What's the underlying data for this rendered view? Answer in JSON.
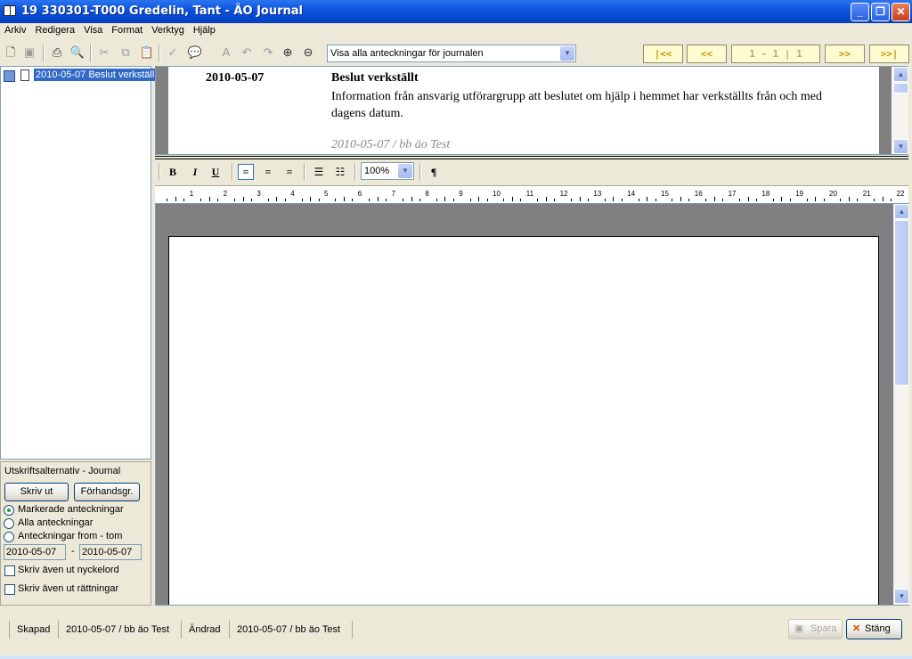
{
  "window": {
    "title": "19 330301-T000 Gredelin, Tant - ÄO Journal",
    "controls": {
      "minimize": "minimize-icon",
      "restore": "restore-icon",
      "close": "close-icon"
    }
  },
  "menu": [
    "Arkiv",
    "Redigera",
    "Visa",
    "Format",
    "Verktyg",
    "Hjälp"
  ],
  "toolbar": {
    "view_filter": "Visa alla anteckningar för journalen",
    "nav_first": "|<<",
    "nav_prev": "<<",
    "nav_position": "1 - 1 | 1",
    "nav_next": ">>",
    "nav_last": ">>|"
  },
  "tree": {
    "items": [
      {
        "label": "2010-05-07 Beslut verkställ"
      }
    ]
  },
  "print_options": {
    "header": "Utskriftsalternativ - Journal",
    "print_button": "Skriv ut",
    "preview_button": "Förhandsgr.",
    "radio_marked": "Markerade anteckningar",
    "radio_all": "Alla anteckningar",
    "radio_range": "Anteckningar from - tom",
    "selected_radio": "marked",
    "date_from": "2010-05-07",
    "date_sep": "-",
    "date_to": "2010-05-07",
    "check_keywords": "Skriv även ut nyckelord",
    "check_corrections": "Skriv även ut rättningar"
  },
  "entry": {
    "date": "2010-05-07",
    "title": "Beslut verkställt",
    "text": "Information från ansvarig utförargrupp att beslutet om hjälp i hemmet har verkställts  från och med dagens datum.",
    "signature": "2010-05-07 / bb äo Test"
  },
  "format": {
    "bold": "B",
    "italic": "I",
    "underline": "U",
    "zoom": "100%",
    "pilcrow": "¶"
  },
  "ruler": {
    "numbers": [
      "1",
      "2",
      "3",
      "4",
      "5",
      "6",
      "7",
      "8",
      "9",
      "10",
      "11",
      "12",
      "13",
      "14",
      "15",
      "16",
      "17",
      "18",
      "19",
      "20",
      "21",
      "22"
    ]
  },
  "status": {
    "created_label": "Skapad",
    "created_value": "2010-05-07 / bb äo Test",
    "changed_label": "Ändrad",
    "changed_value": "2010-05-07 / bb äo Test",
    "save_button": "Spara",
    "close_button": "Stäng"
  },
  "colors": {
    "titlebar": "#0a52dc",
    "selection": "#316ac5",
    "nav_button_bg": "#fffbd0",
    "nav_button_text": "#c89400",
    "doc_background": "#808080"
  }
}
